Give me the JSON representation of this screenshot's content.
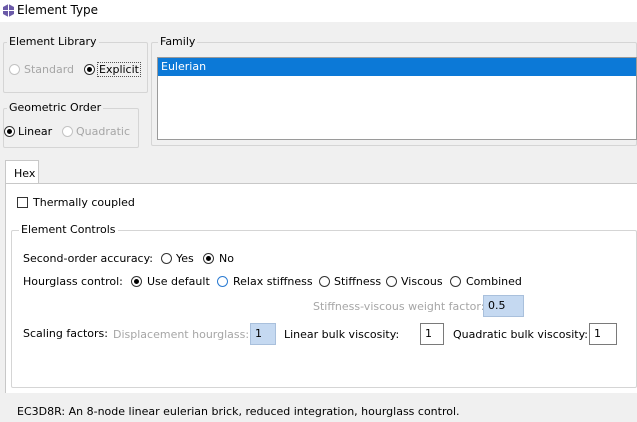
{
  "window": {
    "title": "Element Type",
    "icon": "element-type-icon"
  },
  "element_library": {
    "label": "Element Library",
    "options": [
      {
        "label": "Standard",
        "selected": false,
        "enabled": false
      },
      {
        "label": "Explicit",
        "selected": true,
        "enabled": true
      }
    ]
  },
  "family": {
    "label": "Family",
    "items": [
      {
        "label": "Eulerian",
        "selected": true
      }
    ]
  },
  "geometric_order": {
    "label": "Geometric Order",
    "options": [
      {
        "label": "Linear",
        "selected": true,
        "enabled": true
      },
      {
        "label": "Quadratic",
        "selected": false,
        "enabled": false
      }
    ]
  },
  "tabs": [
    {
      "label": "Hex",
      "active": true
    }
  ],
  "thermally_coupled": {
    "label": "Thermally coupled",
    "checked": false
  },
  "element_controls": {
    "label": "Element Controls",
    "second_order": {
      "label": "Second-order accuracy:",
      "options": [
        {
          "label": "Yes",
          "selected": false
        },
        {
          "label": "No",
          "selected": true
        }
      ]
    },
    "hourglass": {
      "label": "Hourglass control:",
      "options": [
        {
          "label": "Use default",
          "selected": true
        },
        {
          "label": "Relax stiffness",
          "selected": false
        },
        {
          "label": "Stiffness",
          "selected": false
        },
        {
          "label": "Viscous",
          "selected": false
        },
        {
          "label": "Combined",
          "selected": false
        }
      ]
    },
    "weight_factor": {
      "label": "Stiffness-viscous weight factor:",
      "value": "0.5",
      "enabled": false
    },
    "scaling": {
      "label": "Scaling factors:",
      "displacement_hourglass": {
        "label": "Displacement hourglass:",
        "value": "1",
        "enabled": false
      },
      "linear_bulk": {
        "label": "Linear bulk viscosity:",
        "value": "1"
      },
      "quadratic_bulk": {
        "label": "Quadratic bulk viscosity:",
        "value": "1"
      }
    }
  },
  "description": "EC3D8R:  An 8-node linear eulerian brick, reduced integration, hourglass control.",
  "colors": {
    "selection": "#0c79d7",
    "disabled_field": "#c5d9f1",
    "accent_radio": "#2b7bd2"
  }
}
